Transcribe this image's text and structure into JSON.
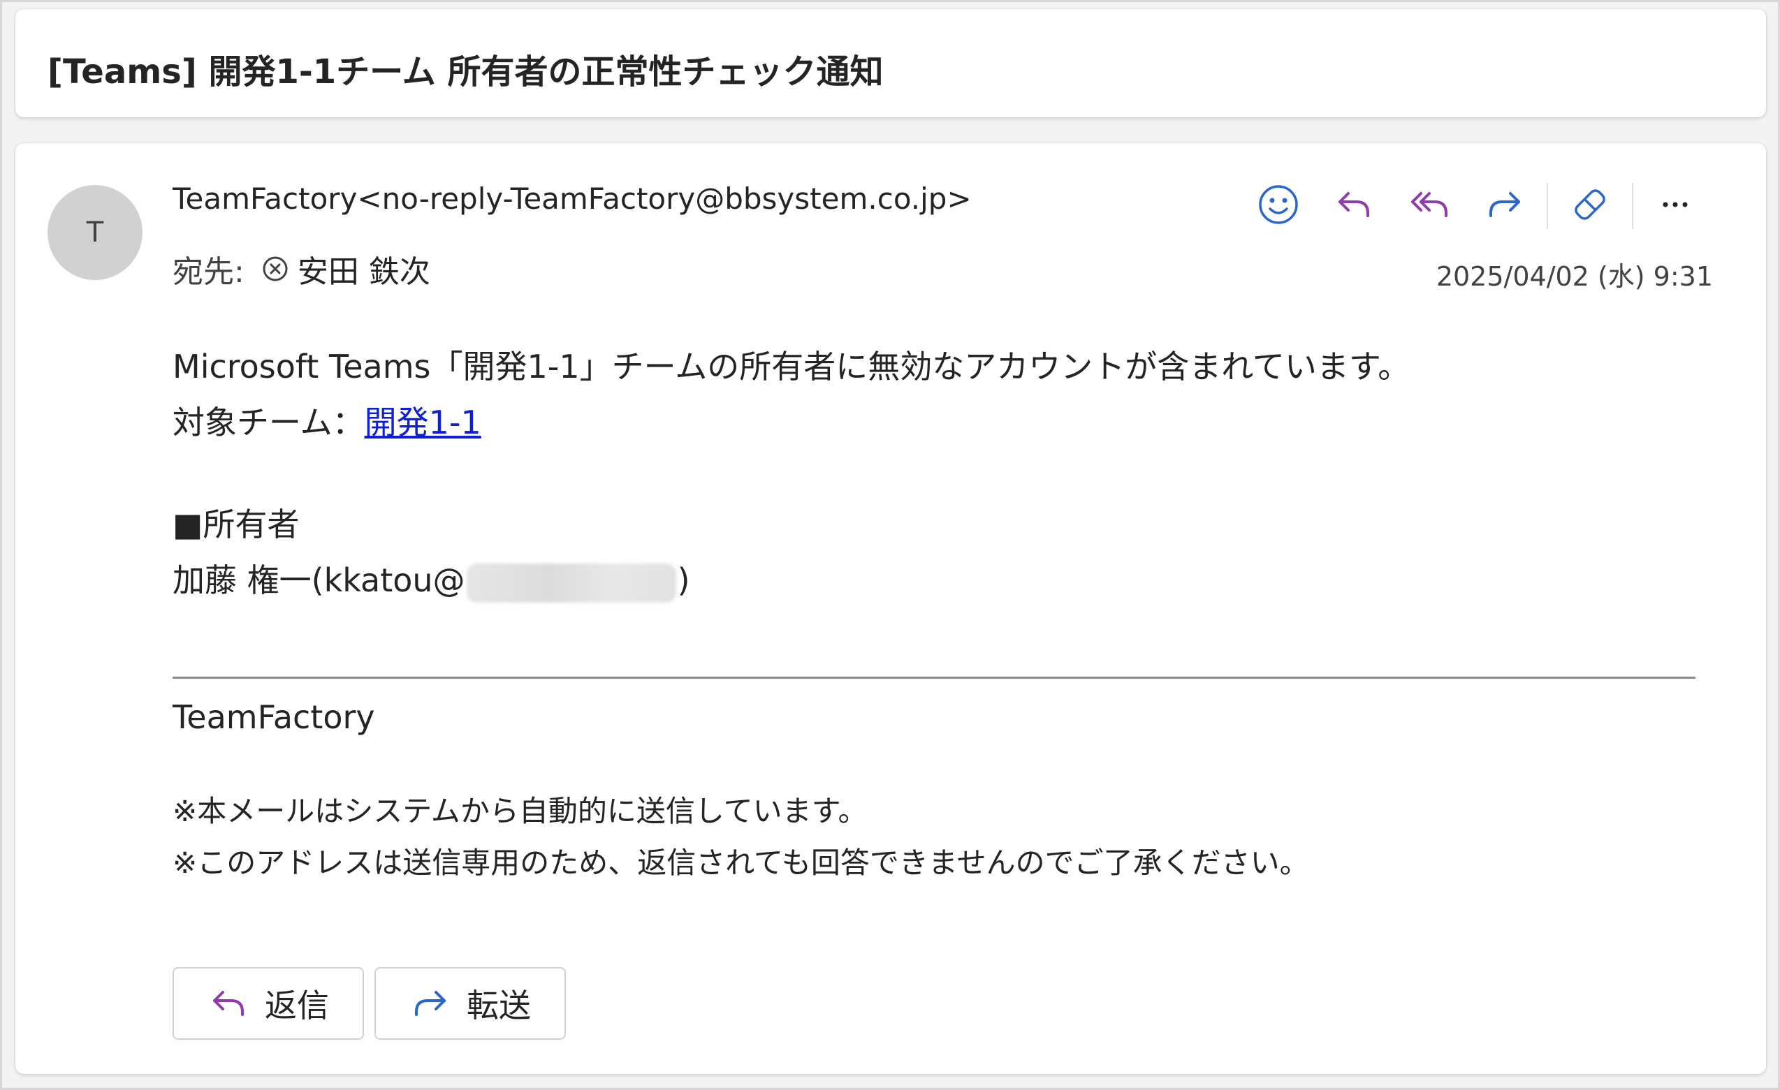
{
  "subject": "[Teams] 開発1-1チーム 所有者の正常性チェック通知",
  "header": {
    "avatar_initial": "T",
    "sender": "TeamFactory<no-reply-TeamFactory@bbsystem.co.jp>",
    "to_label": "宛先:",
    "recipient": "安田 鉄次",
    "date": "2025/04/02 (水) 9:31"
  },
  "toolbar": {
    "icons": [
      "emoji-icon",
      "reply-icon",
      "reply-all-icon",
      "forward-icon",
      "eraser-icon",
      "more-icon"
    ]
  },
  "body": {
    "line1": "Microsoft Teams「開発1-1」チームの所有者に無効なアカウントが含まれています。",
    "target_label": "対象チーム：",
    "target_link": "開発1-1",
    "owner_heading": "■所有者",
    "owner_prefix": "加藤 権一(kkatou@",
    "owner_suffix": ")"
  },
  "signature": {
    "name": "TeamFactory",
    "note1": "※本メールはシステムから自動的に送信しています。",
    "note2": "※このアドレスは送信専用のため、返信されても回答できませんのでご了承ください。"
  },
  "actions": {
    "reply_label": "返信",
    "forward_label": "転送"
  },
  "colors": {
    "accent_purple": "#8e3bab",
    "accent_blue": "#2b66c9",
    "link_blue": "#0f1fd6"
  }
}
